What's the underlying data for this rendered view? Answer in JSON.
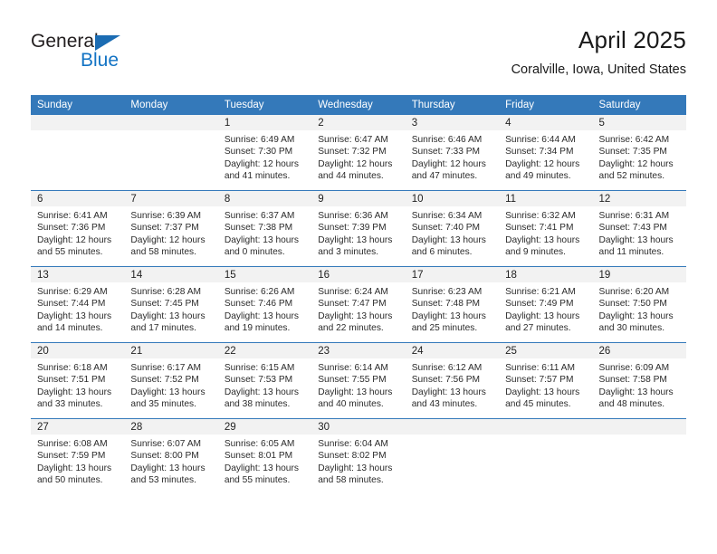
{
  "brand": {
    "name_part1": "General",
    "name_part2": "Blue",
    "triangle_color": "#1b6cb3",
    "blue_color": "#1273c4"
  },
  "header": {
    "title": "April 2025",
    "location": "Coralville, Iowa, United States"
  },
  "theme": {
    "header_row_bg": "#3479ba",
    "header_row_text": "#ffffff",
    "date_strip_bg": "#f2f2f2",
    "grid_line": "#3479ba",
    "page_bg": "#ffffff"
  },
  "weekdays": [
    "Sunday",
    "Monday",
    "Tuesday",
    "Wednesday",
    "Thursday",
    "Friday",
    "Saturday"
  ],
  "weeks": [
    [
      {
        "date": "",
        "sunrise": "",
        "sunset": "",
        "daylight_line1": "",
        "daylight_line2": ""
      },
      {
        "date": "",
        "sunrise": "",
        "sunset": "",
        "daylight_line1": "",
        "daylight_line2": ""
      },
      {
        "date": "1",
        "sunrise": "Sunrise: 6:49 AM",
        "sunset": "Sunset: 7:30 PM",
        "daylight_line1": "Daylight: 12 hours",
        "daylight_line2": "and 41 minutes."
      },
      {
        "date": "2",
        "sunrise": "Sunrise: 6:47 AM",
        "sunset": "Sunset: 7:32 PM",
        "daylight_line1": "Daylight: 12 hours",
        "daylight_line2": "and 44 minutes."
      },
      {
        "date": "3",
        "sunrise": "Sunrise: 6:46 AM",
        "sunset": "Sunset: 7:33 PM",
        "daylight_line1": "Daylight: 12 hours",
        "daylight_line2": "and 47 minutes."
      },
      {
        "date": "4",
        "sunrise": "Sunrise: 6:44 AM",
        "sunset": "Sunset: 7:34 PM",
        "daylight_line1": "Daylight: 12 hours",
        "daylight_line2": "and 49 minutes."
      },
      {
        "date": "5",
        "sunrise": "Sunrise: 6:42 AM",
        "sunset": "Sunset: 7:35 PM",
        "daylight_line1": "Daylight: 12 hours",
        "daylight_line2": "and 52 minutes."
      }
    ],
    [
      {
        "date": "6",
        "sunrise": "Sunrise: 6:41 AM",
        "sunset": "Sunset: 7:36 PM",
        "daylight_line1": "Daylight: 12 hours",
        "daylight_line2": "and 55 minutes."
      },
      {
        "date": "7",
        "sunrise": "Sunrise: 6:39 AM",
        "sunset": "Sunset: 7:37 PM",
        "daylight_line1": "Daylight: 12 hours",
        "daylight_line2": "and 58 minutes."
      },
      {
        "date": "8",
        "sunrise": "Sunrise: 6:37 AM",
        "sunset": "Sunset: 7:38 PM",
        "daylight_line1": "Daylight: 13 hours",
        "daylight_line2": "and 0 minutes."
      },
      {
        "date": "9",
        "sunrise": "Sunrise: 6:36 AM",
        "sunset": "Sunset: 7:39 PM",
        "daylight_line1": "Daylight: 13 hours",
        "daylight_line2": "and 3 minutes."
      },
      {
        "date": "10",
        "sunrise": "Sunrise: 6:34 AM",
        "sunset": "Sunset: 7:40 PM",
        "daylight_line1": "Daylight: 13 hours",
        "daylight_line2": "and 6 minutes."
      },
      {
        "date": "11",
        "sunrise": "Sunrise: 6:32 AM",
        "sunset": "Sunset: 7:41 PM",
        "daylight_line1": "Daylight: 13 hours",
        "daylight_line2": "and 9 minutes."
      },
      {
        "date": "12",
        "sunrise": "Sunrise: 6:31 AM",
        "sunset": "Sunset: 7:43 PM",
        "daylight_line1": "Daylight: 13 hours",
        "daylight_line2": "and 11 minutes."
      }
    ],
    [
      {
        "date": "13",
        "sunrise": "Sunrise: 6:29 AM",
        "sunset": "Sunset: 7:44 PM",
        "daylight_line1": "Daylight: 13 hours",
        "daylight_line2": "and 14 minutes."
      },
      {
        "date": "14",
        "sunrise": "Sunrise: 6:28 AM",
        "sunset": "Sunset: 7:45 PM",
        "daylight_line1": "Daylight: 13 hours",
        "daylight_line2": "and 17 minutes."
      },
      {
        "date": "15",
        "sunrise": "Sunrise: 6:26 AM",
        "sunset": "Sunset: 7:46 PM",
        "daylight_line1": "Daylight: 13 hours",
        "daylight_line2": "and 19 minutes."
      },
      {
        "date": "16",
        "sunrise": "Sunrise: 6:24 AM",
        "sunset": "Sunset: 7:47 PM",
        "daylight_line1": "Daylight: 13 hours",
        "daylight_line2": "and 22 minutes."
      },
      {
        "date": "17",
        "sunrise": "Sunrise: 6:23 AM",
        "sunset": "Sunset: 7:48 PM",
        "daylight_line1": "Daylight: 13 hours",
        "daylight_line2": "and 25 minutes."
      },
      {
        "date": "18",
        "sunrise": "Sunrise: 6:21 AM",
        "sunset": "Sunset: 7:49 PM",
        "daylight_line1": "Daylight: 13 hours",
        "daylight_line2": "and 27 minutes."
      },
      {
        "date": "19",
        "sunrise": "Sunrise: 6:20 AM",
        "sunset": "Sunset: 7:50 PM",
        "daylight_line1": "Daylight: 13 hours",
        "daylight_line2": "and 30 minutes."
      }
    ],
    [
      {
        "date": "20",
        "sunrise": "Sunrise: 6:18 AM",
        "sunset": "Sunset: 7:51 PM",
        "daylight_line1": "Daylight: 13 hours",
        "daylight_line2": "and 33 minutes."
      },
      {
        "date": "21",
        "sunrise": "Sunrise: 6:17 AM",
        "sunset": "Sunset: 7:52 PM",
        "daylight_line1": "Daylight: 13 hours",
        "daylight_line2": "and 35 minutes."
      },
      {
        "date": "22",
        "sunrise": "Sunrise: 6:15 AM",
        "sunset": "Sunset: 7:53 PM",
        "daylight_line1": "Daylight: 13 hours",
        "daylight_line2": "and 38 minutes."
      },
      {
        "date": "23",
        "sunrise": "Sunrise: 6:14 AM",
        "sunset": "Sunset: 7:55 PM",
        "daylight_line1": "Daylight: 13 hours",
        "daylight_line2": "and 40 minutes."
      },
      {
        "date": "24",
        "sunrise": "Sunrise: 6:12 AM",
        "sunset": "Sunset: 7:56 PM",
        "daylight_line1": "Daylight: 13 hours",
        "daylight_line2": "and 43 minutes."
      },
      {
        "date": "25",
        "sunrise": "Sunrise: 6:11 AM",
        "sunset": "Sunset: 7:57 PM",
        "daylight_line1": "Daylight: 13 hours",
        "daylight_line2": "and 45 minutes."
      },
      {
        "date": "26",
        "sunrise": "Sunrise: 6:09 AM",
        "sunset": "Sunset: 7:58 PM",
        "daylight_line1": "Daylight: 13 hours",
        "daylight_line2": "and 48 minutes."
      }
    ],
    [
      {
        "date": "27",
        "sunrise": "Sunrise: 6:08 AM",
        "sunset": "Sunset: 7:59 PM",
        "daylight_line1": "Daylight: 13 hours",
        "daylight_line2": "and 50 minutes."
      },
      {
        "date": "28",
        "sunrise": "Sunrise: 6:07 AM",
        "sunset": "Sunset: 8:00 PM",
        "daylight_line1": "Daylight: 13 hours",
        "daylight_line2": "and 53 minutes."
      },
      {
        "date": "29",
        "sunrise": "Sunrise: 6:05 AM",
        "sunset": "Sunset: 8:01 PM",
        "daylight_line1": "Daylight: 13 hours",
        "daylight_line2": "and 55 minutes."
      },
      {
        "date": "30",
        "sunrise": "Sunrise: 6:04 AM",
        "sunset": "Sunset: 8:02 PM",
        "daylight_line1": "Daylight: 13 hours",
        "daylight_line2": "and 58 minutes."
      },
      {
        "date": "",
        "sunrise": "",
        "sunset": "",
        "daylight_line1": "",
        "daylight_line2": ""
      },
      {
        "date": "",
        "sunrise": "",
        "sunset": "",
        "daylight_line1": "",
        "daylight_line2": ""
      },
      {
        "date": "",
        "sunrise": "",
        "sunset": "",
        "daylight_line1": "",
        "daylight_line2": ""
      }
    ]
  ]
}
